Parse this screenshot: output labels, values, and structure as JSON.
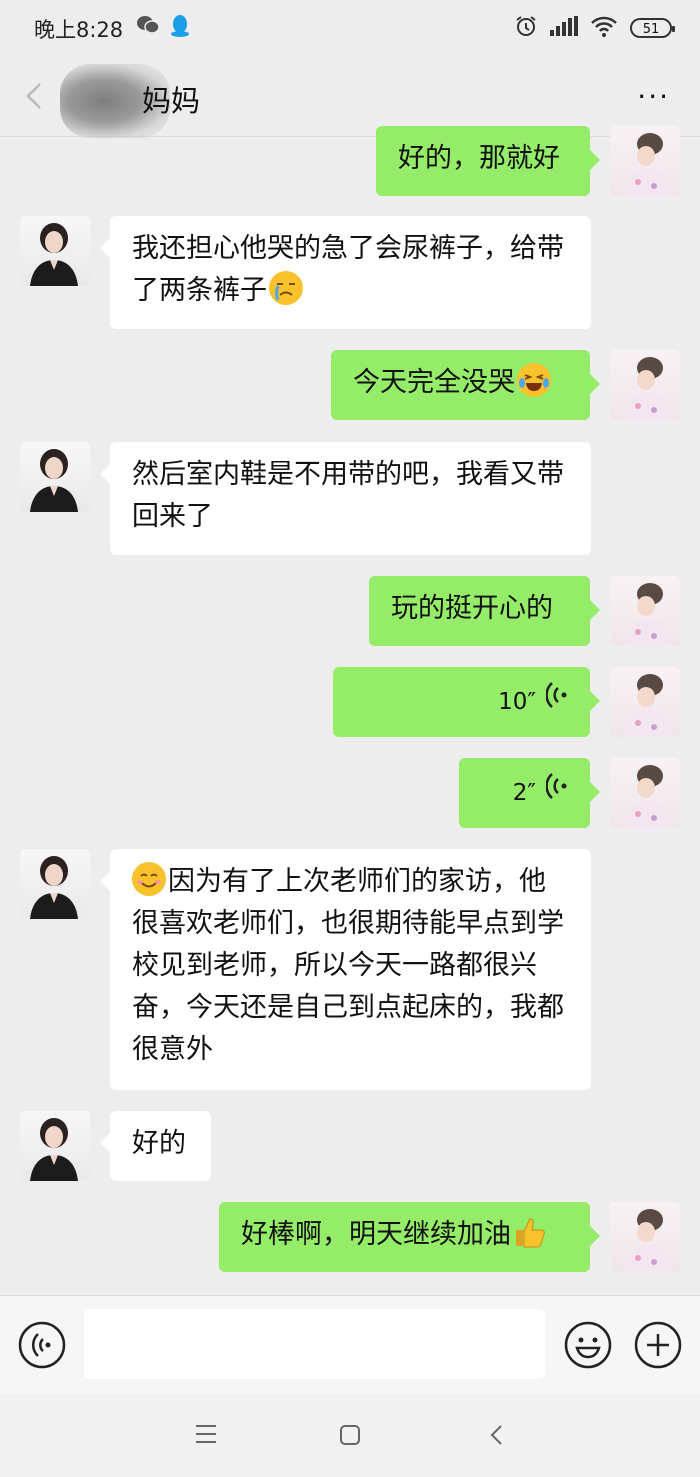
{
  "status_bar": {
    "time": "晚上8:28",
    "battery": "51"
  },
  "header": {
    "title": "妈妈",
    "more_label": "···"
  },
  "messages": [
    {
      "side": "right",
      "text": "好的，那就好"
    },
    {
      "side": "left",
      "text": "我还担心他哭的急了会尿裤子，给带了两条裤子",
      "emoji": "crying-face"
    },
    {
      "side": "right",
      "text": "今天完全没哭",
      "emoji": "laughing-tears"
    },
    {
      "side": "left",
      "text": "然后室内鞋是不用带的吧，我看又带回来了"
    },
    {
      "side": "right",
      "text": "玩的挺开心的"
    },
    {
      "side": "right",
      "type": "voice",
      "duration": "10″"
    },
    {
      "side": "right",
      "type": "voice",
      "duration": "2″"
    },
    {
      "side": "left",
      "emoji": "smiling-face",
      "text": "因为有了上次老师们的家访，他很喜欢老师们，也很期待能早点到学校见到老师，所以今天一路都很兴奋，今天还是自己到点起床的，我都很意外"
    },
    {
      "side": "left",
      "text": "好的"
    },
    {
      "side": "right",
      "text": "好棒啊，明天继续加油",
      "emoji": "thumbs-up"
    }
  ],
  "input": {
    "placeholder": ""
  },
  "colors": {
    "out_bubble": "#95ec69",
    "in_bubble": "#ffffff",
    "background": "#ededed"
  }
}
